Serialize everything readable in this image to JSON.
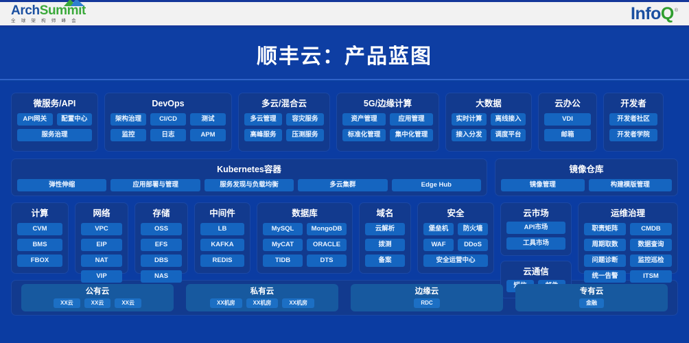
{
  "header": {
    "left_logo": {
      "word_a": "Arch",
      "word_b": "Summit",
      "subtitle": "全 球 架 构 师 峰 会",
      "icon": "mountain-icon"
    },
    "right_logo": {
      "info": "Info",
      "q": "Q",
      "mark": "®"
    }
  },
  "title": "顺丰云：产品蓝图",
  "colors": {
    "page_bg": "#0b3ca2",
    "card_bg": "#123a8e",
    "chip_bg": "#1565c0",
    "accent": "#17599f",
    "title_band": "#0e3ea3",
    "brand_blue": "#1a4fa0",
    "brand_green": "#3aa93a"
  },
  "row1": [
    {
      "title": "微服务/API",
      "rows": [
        [
          "API网关",
          "配置中心"
        ],
        [
          "服务治理"
        ]
      ]
    },
    {
      "title": "DevOps",
      "rows": [
        [
          "架构治理",
          "CI/CD",
          "测试"
        ],
        [
          "监控",
          "日志",
          "APM"
        ]
      ]
    },
    {
      "title": "多云/混合云",
      "rows": [
        [
          "多云管理",
          "容灾服务"
        ],
        [
          "高峰服务",
          "压测服务"
        ]
      ]
    },
    {
      "title": "5G/边缘计算",
      "rows": [
        [
          "资产管理",
          "应用管理"
        ],
        [
          "标准化管理",
          "集中化管理"
        ]
      ]
    },
    {
      "title": "大数据",
      "rows": [
        [
          "实时计算",
          "离线接入"
        ],
        [
          "接入分发",
          "调度平台"
        ]
      ]
    },
    {
      "title": "云办公",
      "rows": [
        [
          "VDI"
        ],
        [
          "邮箱"
        ]
      ]
    },
    {
      "title": "开发者",
      "rows": [
        [
          "开发者社区"
        ],
        [
          "开发者学院"
        ]
      ]
    }
  ],
  "row2": {
    "k8s": {
      "title": "Kubernetes容器",
      "chips": [
        "弹性伸缩",
        "应用部署与管理",
        "服务发现与负载均衡",
        "多云集群",
        "Edge Hub"
      ]
    },
    "registry": {
      "title": "镜像仓库",
      "chips": [
        "镜像管理",
        "构建模版管理"
      ]
    }
  },
  "row3": {
    "compute": {
      "title": "计算",
      "chips": [
        "CVM",
        "BMS",
        "FBOX"
      ]
    },
    "network": {
      "title": "网络",
      "chips": [
        "VPC",
        "EIP",
        "NAT",
        "VIP"
      ]
    },
    "storage": {
      "title": "存储",
      "chips": [
        "OSS",
        "EFS",
        "DBS",
        "NAS"
      ]
    },
    "middleware": {
      "title": "中间件",
      "chips": [
        "LB",
        "KAFKA",
        "REDIS"
      ]
    },
    "database": {
      "title": "数据库",
      "rows": [
        [
          "MySQL",
          "MongoDB"
        ],
        [
          "MyCAT",
          "ORACLE"
        ],
        [
          "TIDB",
          "DTS"
        ]
      ]
    },
    "domain": {
      "title": "域名",
      "chips": [
        "云解析",
        "拨测",
        "备案"
      ]
    },
    "security": {
      "title": "安全",
      "rows": [
        [
          "堡垒机",
          "防火墙"
        ],
        [
          "WAF",
          "DDoS"
        ],
        [
          "安全运营中心"
        ]
      ]
    },
    "market": {
      "title": "云市场",
      "chips": [
        "API市场",
        "工具市场"
      ]
    },
    "communication": {
      "title": "云通信",
      "rows": [
        [
          "短信",
          "邮件"
        ]
      ]
    },
    "ops": {
      "title": "运维治理",
      "rows": [
        [
          "职责矩阵",
          "CMDB"
        ],
        [
          "周期取数",
          "数据查询"
        ],
        [
          "问题诊断",
          "监控巡检"
        ],
        [
          "统一告警",
          "ITSM"
        ]
      ]
    }
  },
  "row4": [
    {
      "title": "公有云",
      "chips": [
        "XX云",
        "XX云",
        "XX云"
      ]
    },
    {
      "title": "私有云",
      "chips": [
        "XX机房",
        "XX机房",
        "XX机房"
      ]
    },
    {
      "title": "边缘云",
      "chips": [
        "RDC"
      ]
    },
    {
      "title": "专有云",
      "chips": [
        "金融"
      ]
    }
  ]
}
